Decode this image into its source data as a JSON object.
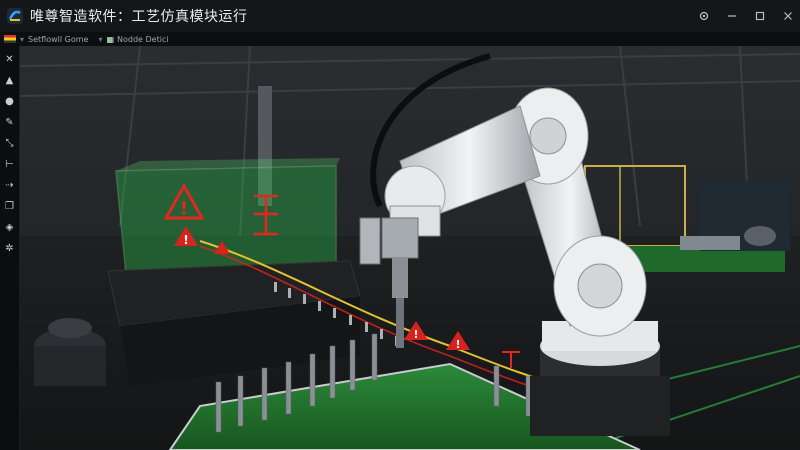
{
  "app": {
    "title": "唯尊智造软件：工艺仿真模块运行"
  },
  "tabs": [
    {
      "label": "Setflowll Gome",
      "icon": "scene-icon"
    },
    {
      "label": "Nodde Detici",
      "icon": "node-icon"
    }
  ],
  "window_controls": [
    {
      "name": "settings-icon"
    },
    {
      "name": "minimize-icon"
    },
    {
      "name": "maximize-icon"
    },
    {
      "name": "close-icon"
    }
  ],
  "tools": [
    "close-x-icon",
    "cone-icon",
    "sphere-icon",
    "pen-icon",
    "transform-icon",
    "measure-icon",
    "path-icon",
    "layers-icon",
    "bucket-icon",
    "gear-icon"
  ],
  "colors": {
    "accent_green": "#27c553",
    "warning_red": "#d8221e",
    "table_green": "#1e6a2c"
  }
}
